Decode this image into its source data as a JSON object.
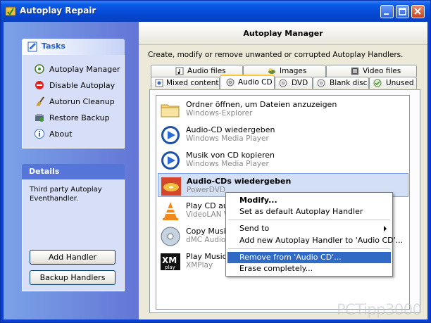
{
  "window": {
    "title": "Autoplay Repair"
  },
  "tasks": {
    "title": "Tasks",
    "items": [
      {
        "label": "Autoplay Manager",
        "icon": "autoplay-icon"
      },
      {
        "label": "Disable Autoplay",
        "icon": "stop-icon"
      },
      {
        "label": "Autorun Cleanup",
        "icon": "broom-icon"
      },
      {
        "label": "Restore Backup",
        "icon": "restore-icon"
      },
      {
        "label": "About",
        "icon": "info-icon"
      }
    ]
  },
  "details": {
    "title": "Details",
    "text": "Third party Autoplay Eventhandler."
  },
  "buttons": {
    "add_handler": "Add Handler",
    "backup_handlers": "Backup Handlers"
  },
  "main": {
    "title": "Autoplay Manager",
    "description": "Create, modify or remove unwanted or corrupted Autoplay Handlers.",
    "tabs_row1": [
      "Audio files",
      "Images",
      "Video files"
    ],
    "tabs_row2": [
      "Mixed content",
      "Audio CD",
      "DVD",
      "Blank disc",
      "Unused"
    ],
    "active_tab": "Audio CD"
  },
  "handlers": [
    {
      "name": "Ordner öffnen, um Dateien anzuzeigen",
      "provider": "Windows-Explorer",
      "icon": "folder-icon"
    },
    {
      "name": "Audio-CD wiedergeben",
      "provider": "Windows Media Player",
      "icon": "media-player-icon"
    },
    {
      "name": "Musik von CD kopieren",
      "provider": "Windows Media Player",
      "icon": "media-player-icon"
    },
    {
      "name": "Audio-CDs wiedergeben",
      "provider": "PowerDVD",
      "icon": "powerdvd-icon",
      "selected": true
    },
    {
      "name": "Play CD audi",
      "provider": "VideoLAN VL",
      "icon": "vlc-cone-icon"
    },
    {
      "name": "Copy Music f",
      "provider": "dMC Audio C",
      "icon": "disc-icon"
    },
    {
      "name": "Play Music",
      "provider": "XMPlay",
      "icon": "xmplay-icon"
    }
  ],
  "context_menu": {
    "items": [
      {
        "label": "Modify...",
        "bold": true
      },
      {
        "label": "Set as default Autoplay Handler"
      },
      {
        "label": "Send to",
        "submenu": true
      },
      {
        "label": "Add new Autoplay Handler to 'Audio CD'..."
      },
      {
        "label": "Remove from 'Audio CD'...",
        "highlighted": true
      },
      {
        "label": "Erase completely..."
      }
    ]
  },
  "watermark": "PCTipp3000",
  "colors": {
    "titlebar": "#0548d4",
    "highlight": "#316ac5",
    "sidebar": "#6f8de0",
    "tab_active_top": "#ffc83c"
  }
}
